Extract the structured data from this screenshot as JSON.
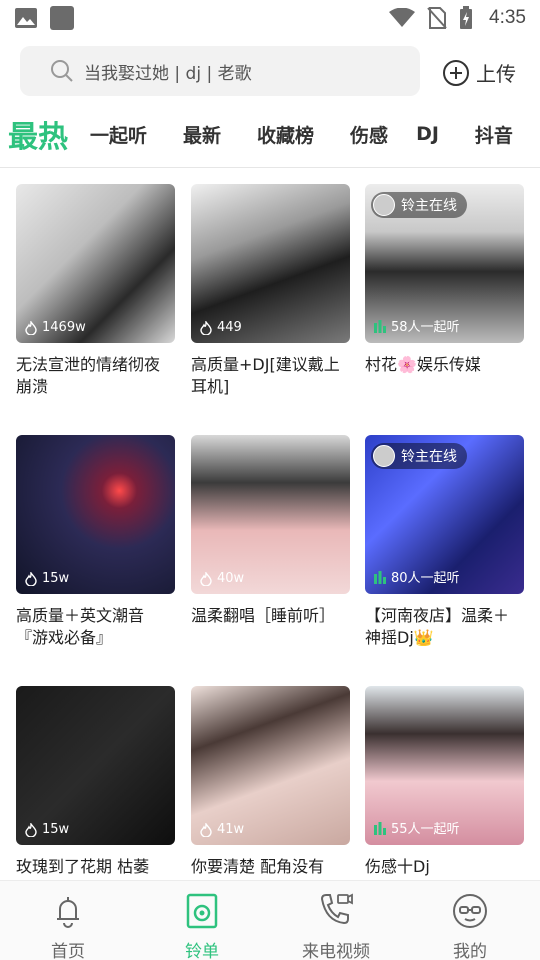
{
  "status_bar": {
    "time": "4:35"
  },
  "search": {
    "placeholder": "当我娶过她 | dj | 老歌",
    "upload_label": "上传"
  },
  "tabs": [
    "最热",
    "一起听",
    "最新",
    "收藏榜",
    "伤感",
    "DJ",
    "抖音"
  ],
  "cards": [
    {
      "title": "无法宣泄的情绪彻夜崩溃",
      "stat": "1469w",
      "owner": ""
    },
    {
      "title": "高质量+DJ[建议戴上耳机]",
      "stat": "449",
      "owner": ""
    },
    {
      "title": "村花🌸娱乐传媒",
      "stat": "58人一起听",
      "owner": "铃主在线"
    },
    {
      "title": "高质量＋英文潮音『游戏必备』",
      "stat": "15w",
      "owner": ""
    },
    {
      "title": "温柔翻唱［睡前听］",
      "stat": "40w",
      "owner": ""
    },
    {
      "title": "【河南夜店】温柔＋神摇Dj👑",
      "stat": "80人一起听",
      "owner": "铃主在线"
    },
    {
      "title": "玫瑰到了花期 枯萎",
      "stat": "15w",
      "owner": ""
    },
    {
      "title": "你要清楚 配角没有",
      "stat": "41w",
      "owner": ""
    },
    {
      "title": "伤感十Dj",
      "stat": "55人一起听",
      "owner": ""
    }
  ],
  "bottom_nav": [
    {
      "label": "首页",
      "icon": "bell-icon"
    },
    {
      "label": "铃单",
      "icon": "playlist-icon"
    },
    {
      "label": "来电视频",
      "icon": "phone-video-icon"
    },
    {
      "label": "我的",
      "icon": "profile-icon"
    }
  ],
  "colors": {
    "accent": "#2ec27e"
  }
}
